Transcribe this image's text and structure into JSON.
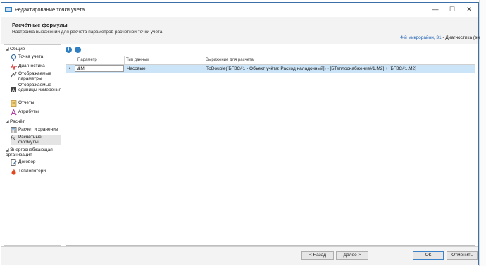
{
  "window": {
    "title": "Редактирование точки учета",
    "minimize": "—",
    "maximize": "☐",
    "close": "✕"
  },
  "header": {
    "title": "Расчётные формулы",
    "subtitle": "Настройка выражений для расчета параметров расчетной точки учета.",
    "crumb_link": "4-й микрорайон, 31",
    "crumb_rest": " - Диагностика (эн"
  },
  "sidebar": {
    "sections": [
      {
        "label": "Общие",
        "items": [
          "Точка учета",
          "Диагностика",
          "Отображаемые параметры",
          "Отображаемые единицы измерения",
          "Отчеты",
          "Атрибуты"
        ]
      },
      {
        "label": "Расчёт",
        "items": [
          "Расчет и хранение",
          "Расчётные формулы"
        ]
      },
      {
        "label": "Энергоснабжающая организация",
        "items": [
          "Договор",
          "Теплопотери"
        ]
      }
    ]
  },
  "grid": {
    "columns": [
      "Параметр",
      "Тип данных",
      "Выражение для расчета"
    ],
    "rows": [
      {
        "indicator": "▸",
        "param": "ΔM",
        "type": "Часовые",
        "expr": "ToDouble([БГВС#1 - Объект учёта: Расход наладочный]) - [БТеплоснабжение#1.M2] + [БГВС#1.M2]"
      }
    ]
  },
  "footer": {
    "back": "< Назад",
    "next": "Далее >",
    "ok": "ОК",
    "cancel": "Отменить"
  },
  "colors": {
    "accent": "#2f7ec1",
    "selection": "#cce4f7",
    "border": "#3d6fa8"
  }
}
